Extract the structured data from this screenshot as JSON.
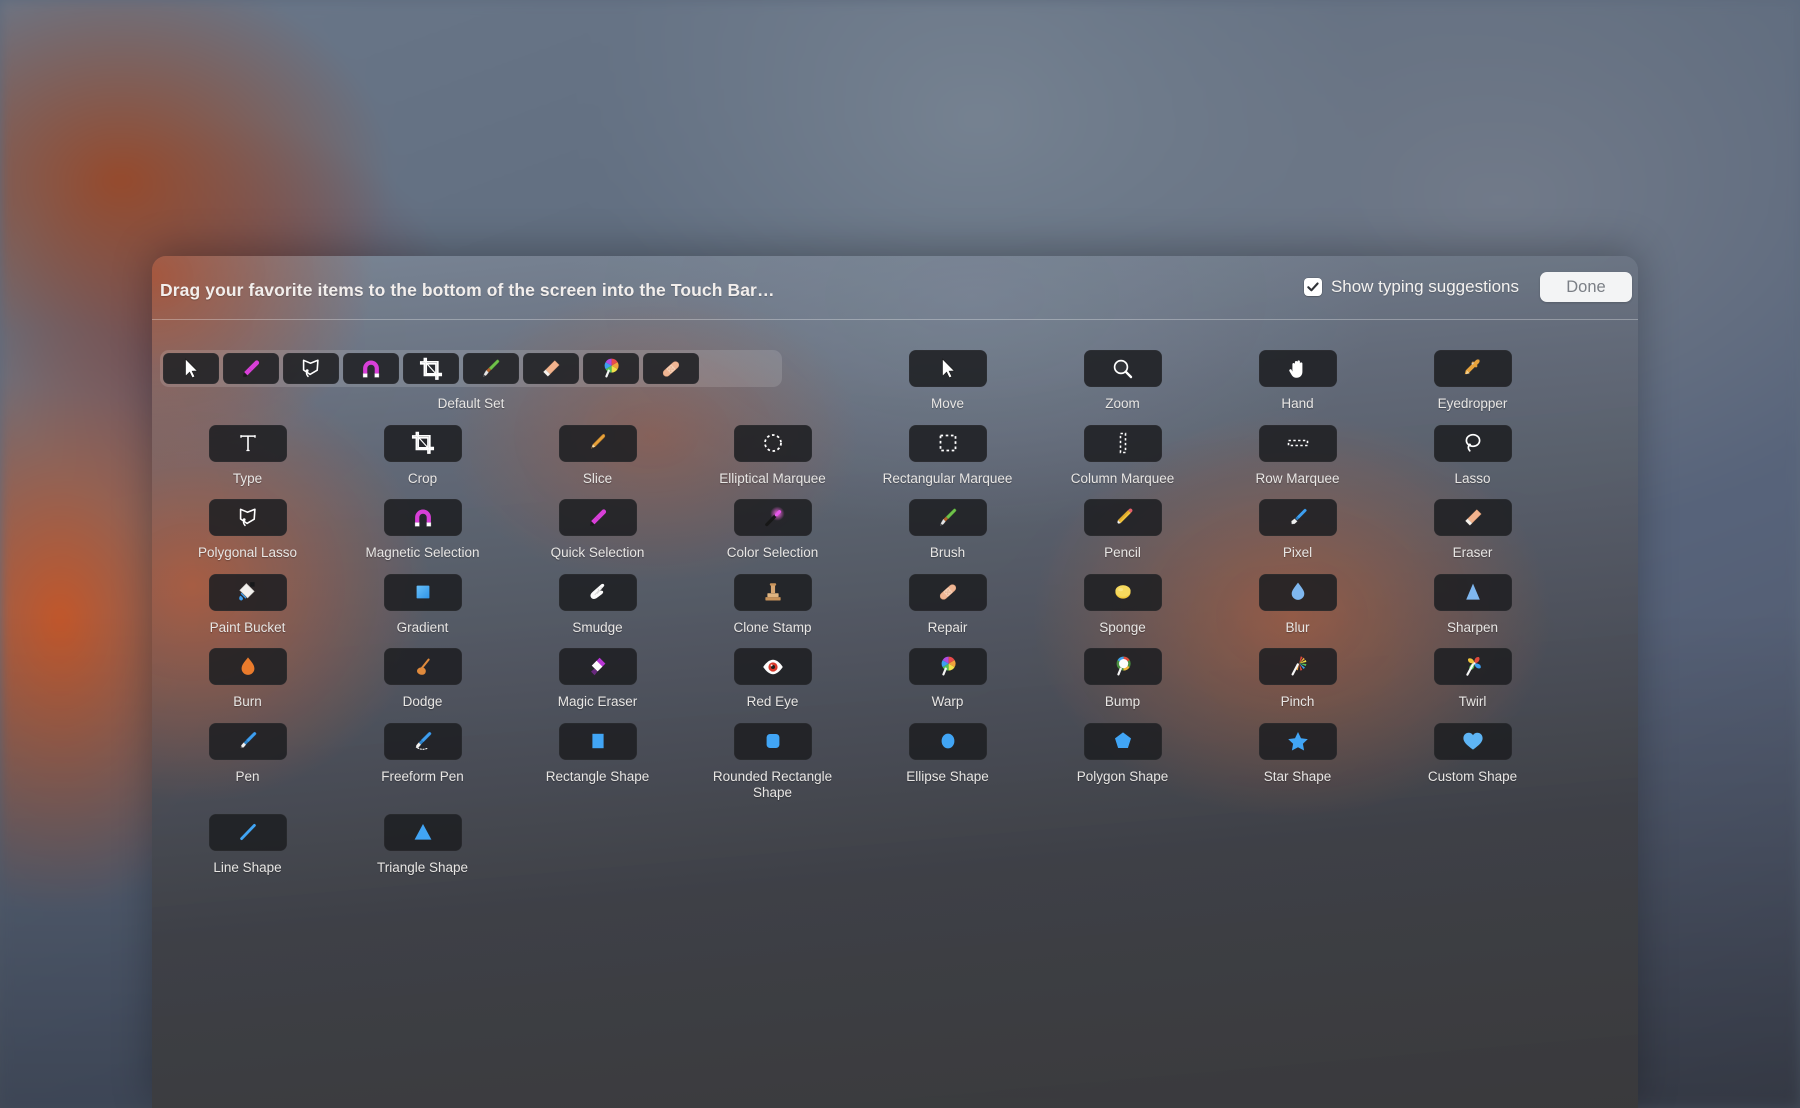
{
  "window": {
    "title": "Drag your favorite items to the bottom of the screen into the Touch Bar…"
  },
  "header": {
    "typing_suggestions_label": "Show typing suggestions",
    "typing_suggestions_checked": true,
    "done_label": "Done",
    "checkbox_icon": "checkmark-icon"
  },
  "default_set": {
    "caption": "Default Set",
    "items": [
      {
        "label": "Move",
        "icon": "cursor-arrow-icon"
      },
      {
        "label": "Quick Selection",
        "icon": "marker-icon"
      },
      {
        "label": "Polygonal Lasso",
        "icon": "polygonal-lasso-icon"
      },
      {
        "label": "Magnetic Selection",
        "icon": "magnet-icon"
      },
      {
        "label": "Crop",
        "icon": "crop-icon"
      },
      {
        "label": "Brush",
        "icon": "paintbrush-icon"
      },
      {
        "label": "Eraser",
        "icon": "eraser-icon"
      },
      {
        "label": "Warp",
        "icon": "lollipop-icon"
      },
      {
        "label": "Repair",
        "icon": "bandage-icon"
      }
    ]
  },
  "grid": {
    "rows": [
      [
        {
          "label": "Default Set",
          "icon": "default-set-strip",
          "type": "strip"
        },
        {
          "label": "Move",
          "icon": "cursor-arrow-icon"
        },
        {
          "label": "Zoom",
          "icon": "magnifier-icon"
        },
        {
          "label": "Hand",
          "icon": "hand-icon"
        },
        {
          "label": "Eyedropper",
          "icon": "eyedropper-icon"
        }
      ],
      [
        {
          "label": "Type",
          "icon": "type-t-icon"
        },
        {
          "label": "Crop",
          "icon": "crop-icon"
        },
        {
          "label": "Slice",
          "icon": "slice-pen-icon"
        },
        {
          "label": "Elliptical Marquee",
          "icon": "elliptical-marquee-icon"
        },
        {
          "label": "Rectangular Marquee",
          "icon": "rectangular-marquee-icon"
        },
        {
          "label": "Column Marquee",
          "icon": "column-marquee-icon"
        },
        {
          "label": "Row Marquee",
          "icon": "row-marquee-icon"
        },
        {
          "label": "Lasso",
          "icon": "lasso-icon"
        }
      ],
      [
        {
          "label": "Polygonal Lasso",
          "icon": "polygonal-lasso-icon"
        },
        {
          "label": "Magnetic Selection",
          "icon": "magnet-icon"
        },
        {
          "label": "Quick Selection",
          "icon": "marker-icon"
        },
        {
          "label": "Color Selection",
          "icon": "color-selection-wand-icon"
        },
        {
          "label": "Brush",
          "icon": "paintbrush-icon"
        },
        {
          "label": "Pencil",
          "icon": "pencil-icon"
        },
        {
          "label": "Pixel",
          "icon": "pixel-brush-icon"
        },
        {
          "label": "Eraser",
          "icon": "eraser-icon"
        }
      ],
      [
        {
          "label": "Paint Bucket",
          "icon": "paint-bucket-icon"
        },
        {
          "label": "Gradient",
          "icon": "gradient-square-icon"
        },
        {
          "label": "Smudge",
          "icon": "smudge-hand-icon"
        },
        {
          "label": "Clone Stamp",
          "icon": "clone-stamp-icon"
        },
        {
          "label": "Repair",
          "icon": "bandage-icon"
        },
        {
          "label": "Sponge",
          "icon": "sponge-icon"
        },
        {
          "label": "Blur",
          "icon": "water-drop-icon"
        },
        {
          "label": "Sharpen",
          "icon": "sharpen-triangle-icon"
        }
      ],
      [
        {
          "label": "Burn",
          "icon": "flame-icon"
        },
        {
          "label": "Dodge",
          "icon": "dodge-icon"
        },
        {
          "label": "Magic Eraser",
          "icon": "magic-eraser-icon"
        },
        {
          "label": "Red Eye",
          "icon": "red-eye-icon"
        },
        {
          "label": "Warp",
          "icon": "lollipop-icon"
        },
        {
          "label": "Bump",
          "icon": "bump-icon"
        },
        {
          "label": "Pinch",
          "icon": "pinch-icon"
        },
        {
          "label": "Twirl",
          "icon": "twirl-pinwheel-icon"
        }
      ],
      [
        {
          "label": "Pen",
          "icon": "pen-icon"
        },
        {
          "label": "Freeform Pen",
          "icon": "freeform-pen-icon"
        },
        {
          "label": "Rectangle Shape",
          "icon": "rectangle-shape-icon"
        },
        {
          "label": "Rounded Rectangle Shape",
          "icon": "rounded-rectangle-shape-icon"
        },
        {
          "label": "Ellipse Shape",
          "icon": "ellipse-shape-icon"
        },
        {
          "label": "Polygon Shape",
          "icon": "polygon-shape-icon"
        },
        {
          "label": "Star Shape",
          "icon": "star-shape-icon"
        },
        {
          "label": "Custom Shape",
          "icon": "heart-shape-icon"
        }
      ],
      [
        {
          "label": "Line Shape",
          "icon": "line-shape-icon"
        },
        {
          "label": "Triangle Shape",
          "icon": "triangle-shape-icon"
        }
      ]
    ]
  },
  "colors": {
    "tile_background": "#1e1f22",
    "accent_blue": "#41a5f5",
    "magenta": "#d83fd8",
    "orange": "#ea8b3a",
    "panel_text": "#e8e6e4"
  }
}
